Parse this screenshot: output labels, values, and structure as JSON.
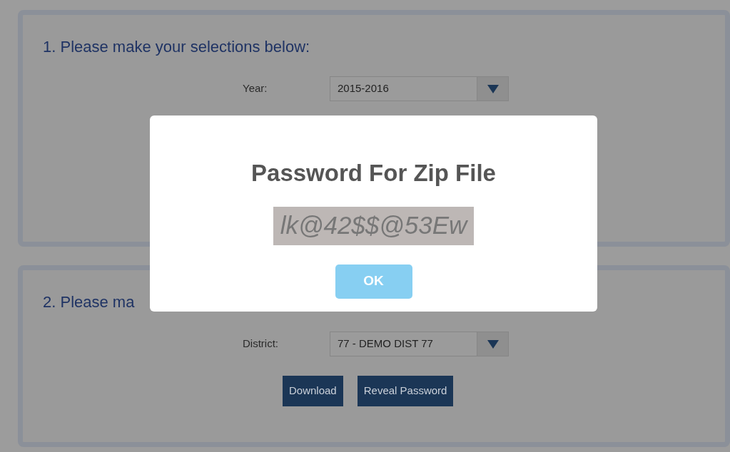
{
  "sections": [
    {
      "heading": "1. Please make your selections below:",
      "fields": [
        {
          "label": "Year:",
          "value": "2015-2016"
        }
      ]
    },
    {
      "heading": "2. Please ma",
      "fields": [
        {
          "label": "District:",
          "value": "77 - DEMO DIST 77"
        }
      ],
      "buttons": [
        "Download",
        "Reveal Password"
      ]
    }
  ],
  "modal": {
    "title": "Password For Zip File",
    "password": "lk@42$$@53Ew",
    "button": "OK"
  }
}
